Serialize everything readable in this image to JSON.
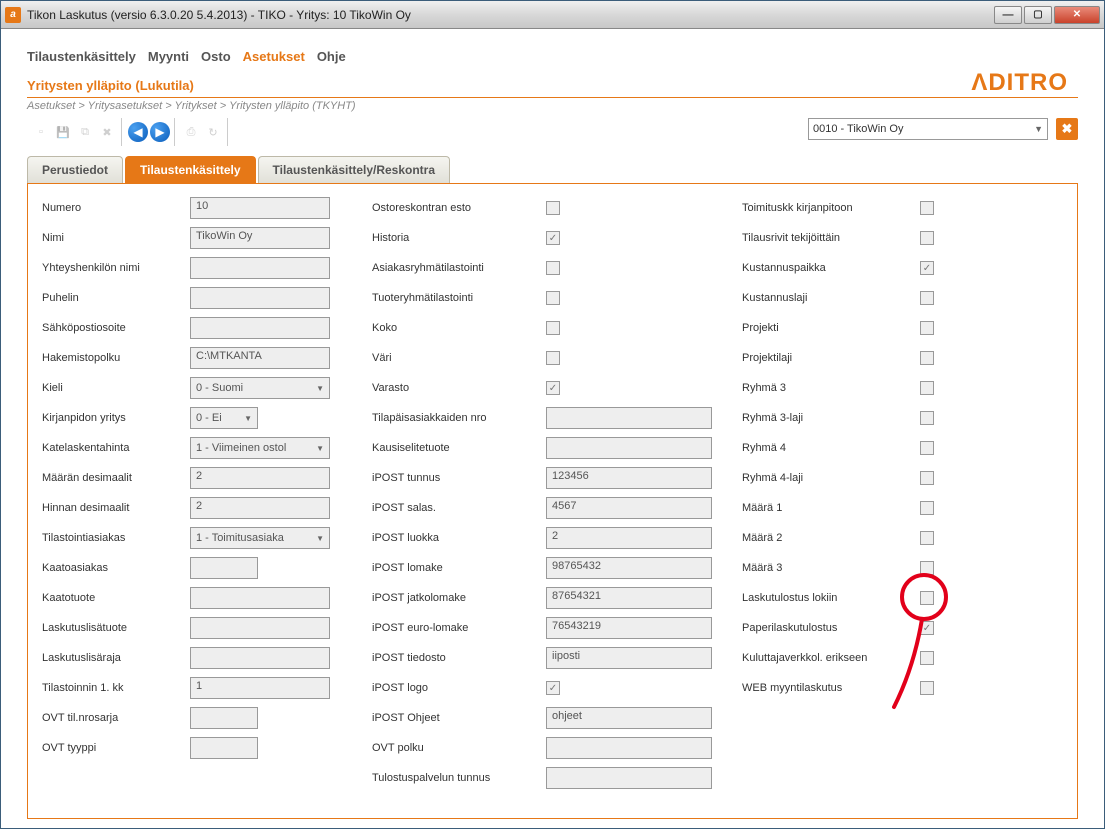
{
  "window": {
    "title": "Tikon Laskutus (versio 6.3.0.20 5.4.2013) - TIKO - Yritys: 10 TikoWin Oy"
  },
  "menu": {
    "items": [
      {
        "label": "Tilaustenkäsittely",
        "active": false
      },
      {
        "label": "Myynti",
        "active": false
      },
      {
        "label": "Osto",
        "active": false
      },
      {
        "label": "Asetukset",
        "active": true
      },
      {
        "label": "Ohje",
        "active": false
      }
    ]
  },
  "subheader": "Yritysten ylläpito (Lukutila)",
  "breadcrumb": "Asetukset > Yritysasetukset > Yritykset > Yritysten ylläpito  (TKYHT)",
  "companySelect": "0010 - TikoWin Oy",
  "tabs": [
    {
      "label": "Perustiedot",
      "active": false
    },
    {
      "label": "Tilaustenkäsittely",
      "active": true
    },
    {
      "label": "Tilaustenkäsittely/Reskontra",
      "active": false
    }
  ],
  "col1": [
    {
      "label": "Numero",
      "type": "text",
      "value": "10",
      "w": "lg"
    },
    {
      "label": "Nimi",
      "type": "text",
      "value": "TikoWin Oy",
      "w": "lg"
    },
    {
      "label": "Yhteyshenkilön nimi",
      "type": "text",
      "value": "",
      "w": "lg"
    },
    {
      "label": "Puhelin",
      "type": "text",
      "value": "",
      "w": "lg"
    },
    {
      "label": "Sähköpostiosoite",
      "type": "text",
      "value": "",
      "w": "lg"
    },
    {
      "label": "Hakemistopolku",
      "type": "text",
      "value": "C:\\MTKANTA",
      "w": "lg"
    },
    {
      "label": "Kieli",
      "type": "select",
      "value": "0 - Suomi",
      "w": "lg"
    },
    {
      "label": "Kirjanpidon yritys",
      "type": "select",
      "value": "0 - Ei",
      "w": "sm"
    },
    {
      "label": "Katelaskentahinta",
      "type": "select",
      "value": "1 - Viimeinen ostol",
      "w": "lg"
    },
    {
      "label": "Määrän desimaalit",
      "type": "text",
      "value": "2",
      "w": "lg"
    },
    {
      "label": "Hinnan desimaalit",
      "type": "text",
      "value": "2",
      "w": "lg"
    },
    {
      "label": "Tilastointiasiakas",
      "type": "select",
      "value": "1 - Toimitusasiaka",
      "w": "lg"
    },
    {
      "label": "Kaatoasiakas",
      "type": "text",
      "value": "",
      "w": "sm"
    },
    {
      "label": "Kaatotuote",
      "type": "text",
      "value": "",
      "w": "lg"
    },
    {
      "label": "Laskutuslisätuote",
      "type": "text",
      "value": "",
      "w": "lg"
    },
    {
      "label": "Laskutuslisäraja",
      "type": "text",
      "value": "",
      "w": "lg"
    },
    {
      "label": "Tilastoinnin 1. kk",
      "type": "text",
      "value": "1",
      "w": "lg"
    },
    {
      "label": "OVT til.nrosarja",
      "type": "text",
      "value": "",
      "w": "sm"
    },
    {
      "label": "OVT tyyppi",
      "type": "text",
      "value": "",
      "w": "sm"
    }
  ],
  "col2": [
    {
      "label": "Ostoreskontran esto",
      "type": "check",
      "checked": false
    },
    {
      "label": "Historia",
      "type": "check",
      "checked": true
    },
    {
      "label": "Asiakasryhmätilastointi",
      "type": "check",
      "checked": false
    },
    {
      "label": "Tuoteryhmätilastointi",
      "type": "check",
      "checked": false
    },
    {
      "label": "Koko",
      "type": "check",
      "checked": false
    },
    {
      "label": "Väri",
      "type": "check",
      "checked": false
    },
    {
      "label": "Varasto",
      "type": "check",
      "checked": true
    },
    {
      "label": "Tilapäisasiakkaiden nro",
      "type": "text",
      "value": ""
    },
    {
      "label": "Kausiselitetuote",
      "type": "text",
      "value": ""
    },
    {
      "label": "iPOST tunnus",
      "type": "text",
      "value": "123456"
    },
    {
      "label": "iPOST salas.",
      "type": "text",
      "value": "4567"
    },
    {
      "label": "iPOST luokka",
      "type": "text",
      "value": "2"
    },
    {
      "label": "iPOST lomake",
      "type": "text",
      "value": "98765432"
    },
    {
      "label": "iPOST jatkolomake",
      "type": "text",
      "value": "87654321"
    },
    {
      "label": "iPOST euro-lomake",
      "type": "text",
      "value": "76543219"
    },
    {
      "label": "iPOST tiedosto",
      "type": "text",
      "value": "iiposti"
    },
    {
      "label": "iPOST logo",
      "type": "check",
      "checked": true
    },
    {
      "label": "iPOST Ohjeet",
      "type": "text",
      "value": "ohjeet"
    },
    {
      "label": "OVT polku",
      "type": "text",
      "value": ""
    },
    {
      "label": "Tulostuspalvelun tunnus",
      "type": "text",
      "value": ""
    }
  ],
  "col3": [
    {
      "label": "Toimituskk kirjanpitoon",
      "checked": false
    },
    {
      "label": "Tilausrivit tekijöittäin",
      "checked": false
    },
    {
      "label": "Kustannuspaikka",
      "checked": true
    },
    {
      "label": "Kustannuslaji",
      "checked": false
    },
    {
      "label": "Projekti",
      "checked": false
    },
    {
      "label": "Projektilaji",
      "checked": false
    },
    {
      "label": "Ryhmä 3",
      "checked": false
    },
    {
      "label": "Ryhmä 3-laji",
      "checked": false
    },
    {
      "label": "Ryhmä 4",
      "checked": false
    },
    {
      "label": "Ryhmä 4-laji",
      "checked": false
    },
    {
      "label": "Määrä 1",
      "checked": false
    },
    {
      "label": "Määrä 2",
      "checked": false
    },
    {
      "label": "Määrä 3",
      "checked": false
    },
    {
      "label": "Laskutulostus lokiin",
      "checked": false
    },
    {
      "label": "Paperilaskutulostus",
      "checked": true,
      "highlight": true
    },
    {
      "label": "Kuluttajaverkkol. erikseen",
      "checked": false
    },
    {
      "label": "WEB myyntilaskutus",
      "checked": false
    }
  ]
}
